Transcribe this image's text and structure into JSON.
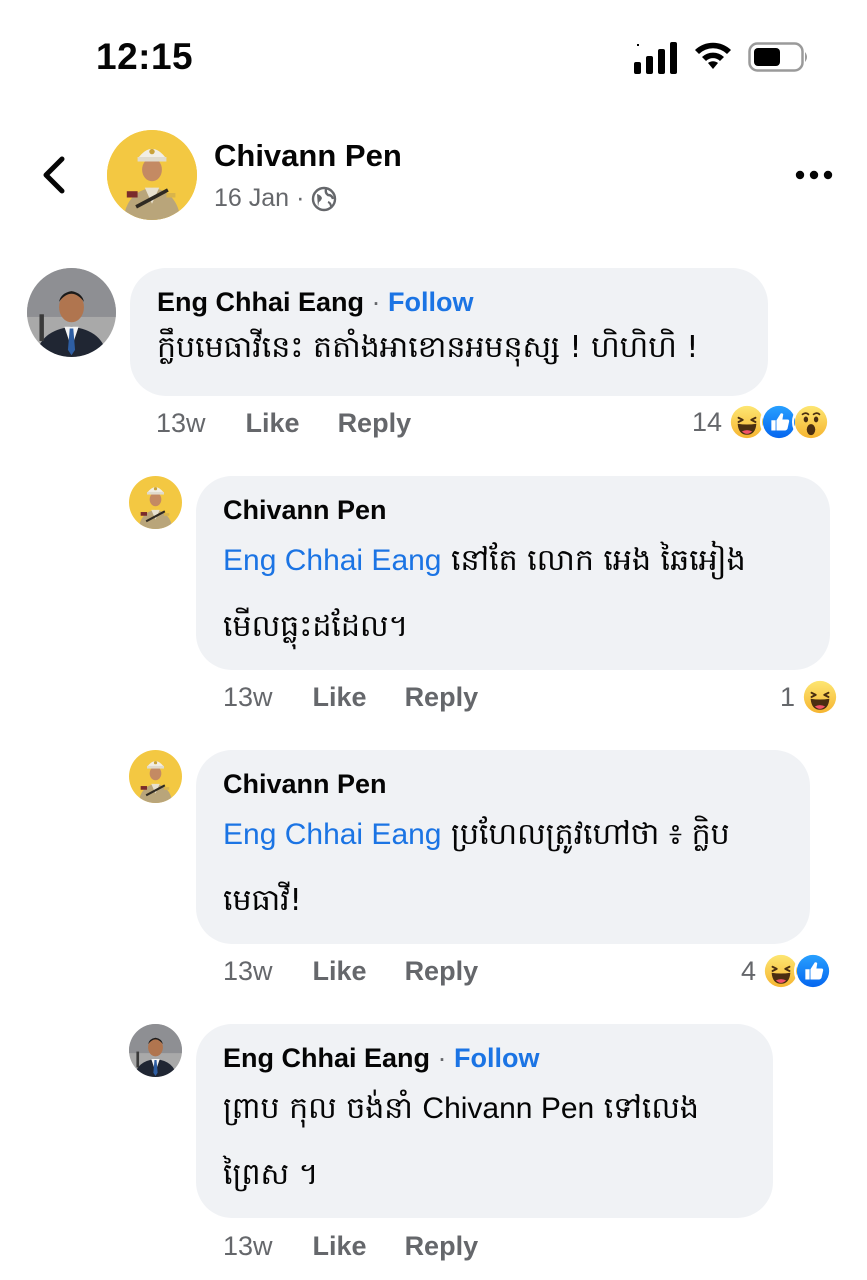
{
  "status_bar": {
    "time": "12:15"
  },
  "post": {
    "author": "Chivann Pen",
    "date": "16 Jan",
    "separator": "·"
  },
  "comments": [
    {
      "author": "Eng Chhai Eang",
      "follow_label": "Follow",
      "text": "ក្លឹបមេធាវីនេះ តតាំងអាខោនអមនុស្ស ! ហិហិហិ !",
      "time": "13w",
      "like_label": "Like",
      "reply_label": "Reply",
      "reaction_count": "14",
      "reactions": [
        "haha-icon",
        "like-icon",
        "wow-icon"
      ]
    },
    {
      "author": "Chivann Pen",
      "mention": "Eng Chhai Eang",
      "text_line1": " នៅតែ លោក អេង ឆៃអៀង",
      "text_line2": "មើលធ្លុះដដែល។",
      "time": "13w",
      "like_label": "Like",
      "reply_label": "Reply",
      "reaction_count": "1",
      "reactions": [
        "haha-icon"
      ]
    },
    {
      "author": "Chivann Pen",
      "mention": "Eng Chhai Eang",
      "text_line1": " ប្រហែលត្រូវហៅថា ៖ ក្លិប",
      "text_line2": "មេធាវី!",
      "time": "13w",
      "like_label": "Like",
      "reply_label": "Reply",
      "reaction_count": "4",
      "reactions": [
        "haha-icon",
        "like-icon"
      ]
    },
    {
      "author": "Eng Chhai Eang",
      "follow_label": "Follow",
      "text_a": "ព្រាប កុល ចង់នាំ ",
      "text_mention": "Chivann Pen",
      "text_b": " ទៅលេង",
      "text_line2": "ព្រៃស ។",
      "time": "13w",
      "like_label": "Like",
      "reply_label": "Reply"
    }
  ]
}
